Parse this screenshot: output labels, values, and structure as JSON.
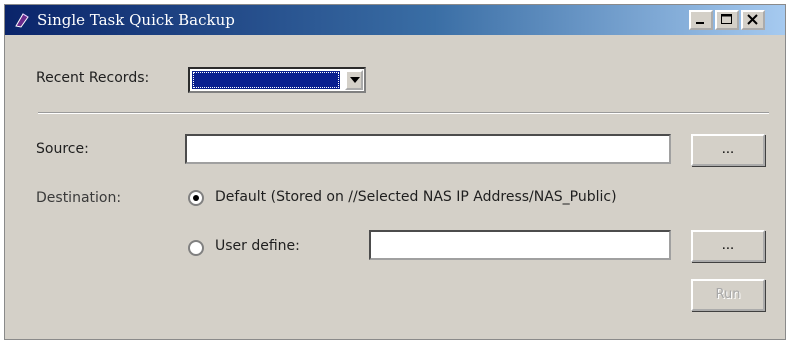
{
  "window": {
    "title": "Single Task Quick Backup",
    "controls": {
      "minimize_icon": "minimize-icon",
      "maximize_icon": "maximize-icon",
      "close_icon": "close-icon"
    }
  },
  "recent_records": {
    "label": "Recent Records:",
    "selected_value": ""
  },
  "source": {
    "label": "Source:",
    "value": "",
    "browse_label": "..."
  },
  "destination": {
    "label": "Destination:",
    "default_option": {
      "label": "Default (Stored on //Selected NAS IP Address/NAS_Public)",
      "checked": true
    },
    "user_define_option": {
      "label": "User define:",
      "checked": false
    },
    "user_define_value": "",
    "browse_label": "..."
  },
  "run_button": {
    "label": "Run",
    "enabled": false
  },
  "colors": {
    "titlebar_start": "#0a246a",
    "titlebar_end": "#a6caf0",
    "face": "#d4d0c8",
    "selection": "#0a1f8f"
  }
}
